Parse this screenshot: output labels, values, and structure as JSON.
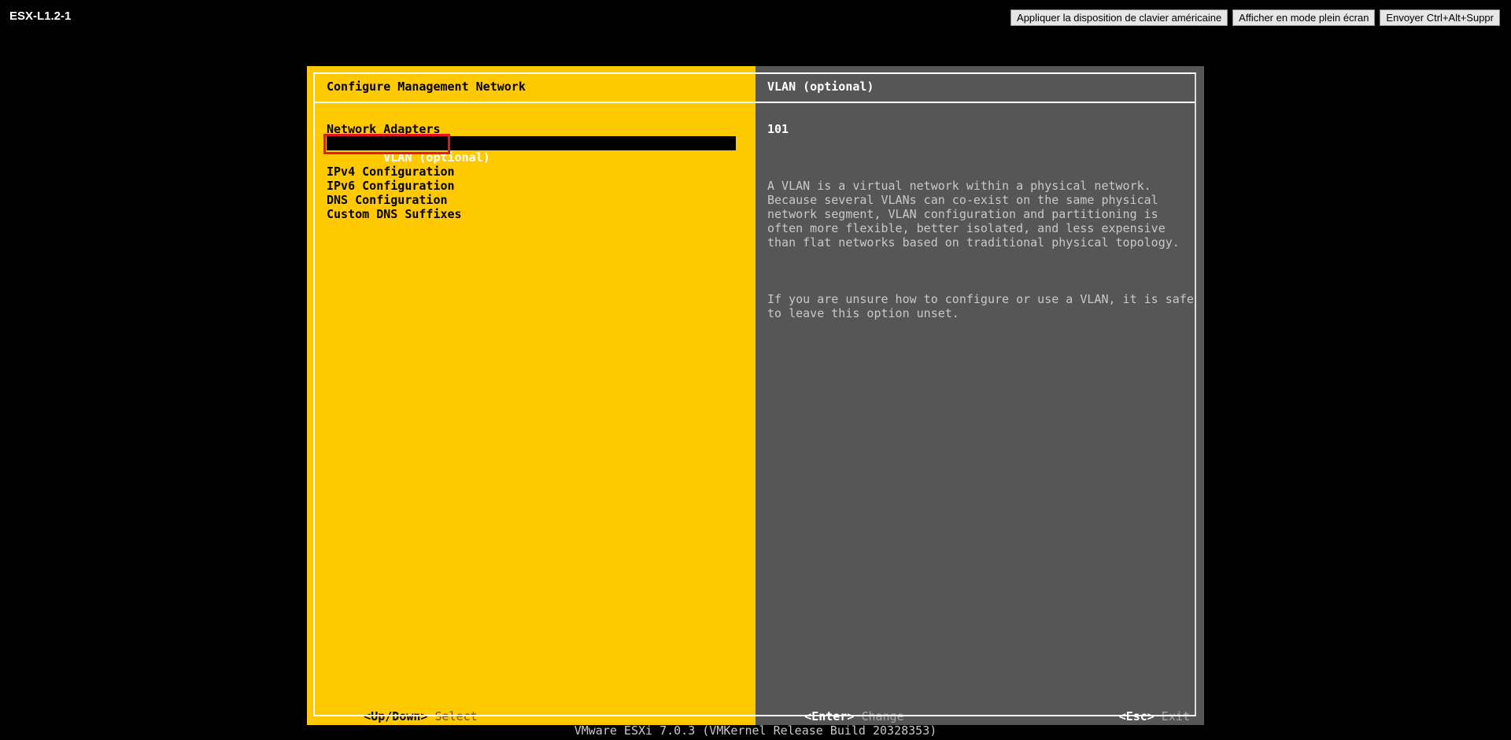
{
  "window": {
    "vm_name": "ESX-L1.2-1"
  },
  "toolbar": {
    "keyboard_layout_label": "Appliquer la disposition de clavier américaine",
    "fullscreen_label": "Afficher en mode plein écran",
    "send_cad_label": "Envoyer Ctrl+Alt+Suppr"
  },
  "left_pane": {
    "title": "Configure Management Network",
    "menu_items": [
      "Network Adapters",
      "VLAN (optional)",
      "IPv4 Configuration",
      "IPv6 Configuration",
      "DNS Configuration",
      "Custom DNS Suffixes"
    ],
    "selected_index": 1,
    "footer": {
      "key": "<Up/Down>",
      "action": "Select"
    }
  },
  "right_pane": {
    "title": "VLAN (optional)",
    "value": "101",
    "help_paragraphs": [
      "A VLAN is a virtual network within a physical network.\nBecause several VLANs can co-exist on the same physical\nnetwork segment, VLAN configuration and partitioning is\noften more flexible, better isolated, and less expensive\nthan flat networks based on traditional physical topology.",
      "If you are unsure how to configure or use a VLAN, it is safe\nto leave this option unset."
    ],
    "footer_left": {
      "key": "<Enter>",
      "action": "Change"
    },
    "footer_right": {
      "key": "<Esc>",
      "action": "Exit"
    }
  },
  "status_line": "VMware ESXi 7.0.3 (VMKernel Release Build 20328353)",
  "colors": {
    "left_pane_bg": "#ffc900",
    "right_pane_bg": "#565656",
    "selection_highlight": "#e8141e"
  }
}
